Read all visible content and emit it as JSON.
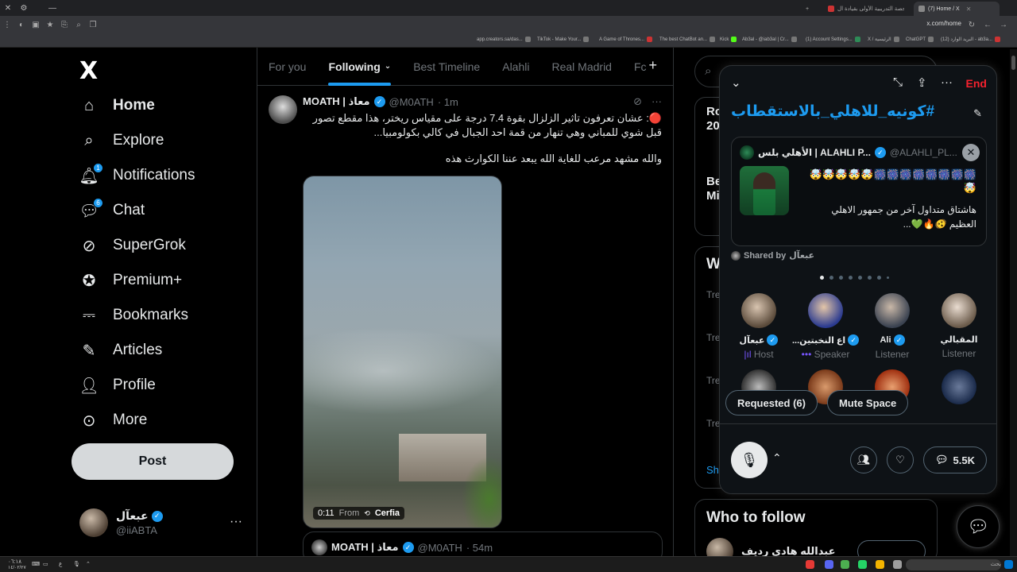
{
  "browser": {
    "tabs": [
      {
        "title": "(7) Home / X"
      },
      {
        "title": "الحصة التدريبية الأولى بقيادة ال..."
      }
    ],
    "url": "x.com/home",
    "bookmarks": [
      "app.creators.sa/das...",
      "TikTok - Make Your...",
      "A Game of Thrones...",
      "The best ChatBot an...",
      "Kick",
      "Ab3al - @iab3al | Cr...",
      "(1) Account Settings...",
      "X / الرئيسية",
      "ChatGPT",
      "(12) البريد الوارد - ab3a..."
    ]
  },
  "sidebar": {
    "logo": "X",
    "items": [
      {
        "label": "Home",
        "icon": "home-icon"
      },
      {
        "label": "Explore",
        "icon": "search-icon"
      },
      {
        "label": "Notifications",
        "icon": "bell-icon",
        "badge": "1"
      },
      {
        "label": "Chat",
        "icon": "chat-icon",
        "badge": "6"
      },
      {
        "label": "SuperGrok",
        "icon": "grok-icon"
      },
      {
        "label": "Premium+",
        "icon": "premium-icon"
      },
      {
        "label": "Bookmarks",
        "icon": "bookmark-icon"
      },
      {
        "label": "Articles",
        "icon": "articles-icon"
      },
      {
        "label": "Profile",
        "icon": "profile-icon"
      },
      {
        "label": "More",
        "icon": "more-icon"
      }
    ],
    "post_label": "Post",
    "account": {
      "name": "عبعآل",
      "handle": "@iiABTA",
      "menu": "···"
    }
  },
  "feed": {
    "tabs": [
      "For you",
      "Following",
      "Best Timeline",
      "Alahli",
      "Real Madrid",
      "Fc"
    ],
    "active_tab": "Following",
    "tweet": {
      "name": "MOATH | معاذ",
      "handle": "@M0ATH",
      "time": "· 1m",
      "text": "🔴: عشان تعرفون تاثير الزلزال بقوة 7.4 درجة على مقياس ريختر، هذا مقطع تصور قبل شوي للمباني وهي تنهار من قمة احد الجبال في كالي بكولومبيا...",
      "text2": "والله مشهد مرعب للغاية الله يبعد عننا الكوارث هذه",
      "video_time": "0:11",
      "video_from": "From",
      "video_source": "Cerfia"
    },
    "quoted": {
      "name": "MOATH | معاذ",
      "handle": "@M0ATH",
      "time": "· 54m"
    }
  },
  "right": {
    "trend_fragments": [
      "Ro",
      "20",
      "Be",
      "Mi",
      "W",
      "Tre",
      "Tre",
      "Tre",
      "Tre",
      "Sh"
    ],
    "who_to_follow": "Who to follow",
    "suggest_name": "عبدالله هادي رديف"
  },
  "space": {
    "end_label": "End",
    "title": "#كونيه_للاهلي_بالاستقطاب",
    "pinned": {
      "name": "الأهلي بلس | ALAHLI P...",
      "handle": "@ALAHLI_PL...",
      "emoji_line": "🤯🤯🤯🤯🤯🎆🎆🎆🎆🎆🎆🎆🎆🤯",
      "text": "هاشتاق متداول آخر من جمهور الاهلي العظيم 🫨🔥💚..."
    },
    "shared_label": "Shared by",
    "shared_by": "عبعآل",
    "page_dots": 8,
    "active_dot": 0,
    "people": [
      {
        "name": "عبعآل",
        "role": "Host",
        "verified": true
      },
      {
        "name": "...اع النخبتين",
        "role": "Speaker",
        "verified": true
      },
      {
        "name": "Ali",
        "role": "Listener",
        "verified": true
      },
      {
        "name": "المقبالي",
        "role": "Listener",
        "verified": false
      }
    ],
    "requested_label": "Requested (6)",
    "mute_label": "Mute Space",
    "count": "5.5K"
  },
  "taskbar": {
    "clock": "٠٦:١٨",
    "date": "١٤/٠٢/٢٧",
    "lang": "ع",
    "search_placeholder": "بحث"
  },
  "colors": {
    "accent": "#1d9bf0",
    "danger": "#f4212e",
    "host": "#7856ff"
  }
}
